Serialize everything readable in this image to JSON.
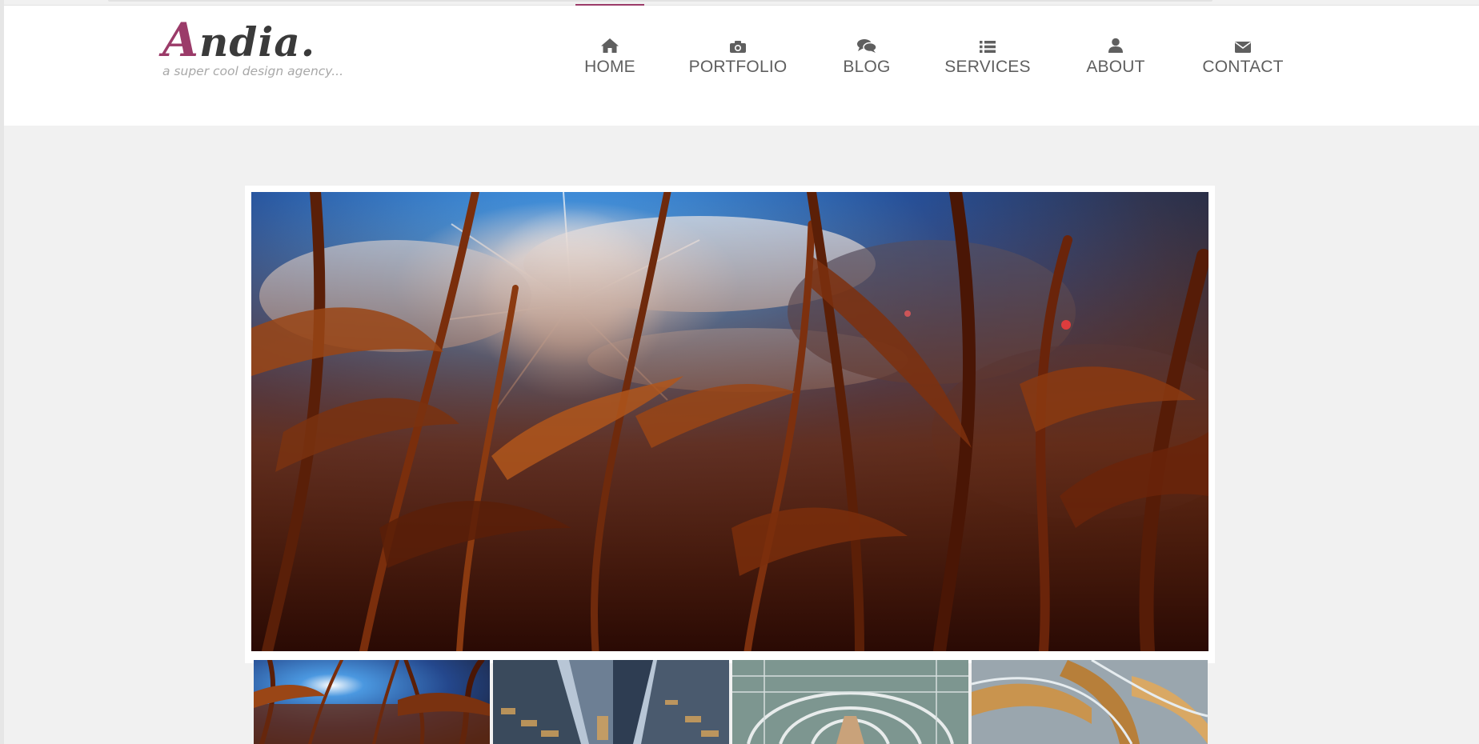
{
  "brand": {
    "name_initial": "A",
    "name_rest": "ndia.",
    "tagline": "a super cool design agency...",
    "accent_color": "#9b3b69",
    "text_color": "#3a3a3a"
  },
  "nav": {
    "items": [
      {
        "label": "HOME",
        "icon": "home-icon",
        "active": true
      },
      {
        "label": "PORTFOLIO",
        "icon": "camera-icon",
        "active": false
      },
      {
        "label": "BLOG",
        "icon": "comments-icon",
        "active": false
      },
      {
        "label": "SERVICES",
        "icon": "list-icon",
        "active": false
      },
      {
        "label": "ABOUT",
        "icon": "user-icon",
        "active": false
      },
      {
        "label": "CONTACT",
        "icon": "envelope-icon",
        "active": false
      }
    ]
  },
  "slider": {
    "main_image": {
      "subject": "cornfield-sun-sky-photo"
    },
    "thumbnails": [
      {
        "subject": "cornfield-sun-sky-photo",
        "selected": true
      },
      {
        "subject": "skyscrapers-photo",
        "selected": false
      },
      {
        "subject": "glass-walkway-tunnel-photo",
        "selected": false
      },
      {
        "subject": "spiral-staircase-photo",
        "selected": false
      }
    ]
  }
}
